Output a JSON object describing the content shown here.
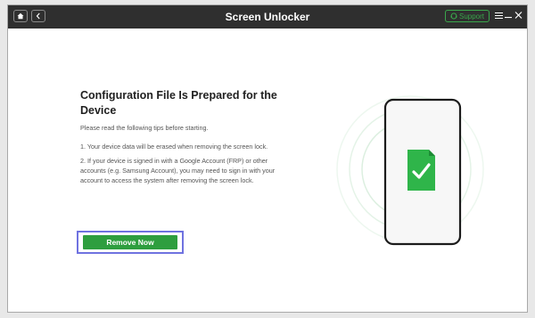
{
  "window": {
    "title": "Screen Unlocker"
  },
  "titlebar": {
    "support_label": "Support"
  },
  "content": {
    "heading": "Configuration File Is Prepared for the Device",
    "intro": "Please read the following tips before starting.",
    "tips": [
      "1. Your device data will be erased when removing the screen lock.",
      "2. If your device is signed in with a Google Account (FRP) or other accounts (e.g. Samsung Account), you may need to sign in with your account to access the system after removing the screen lock."
    ],
    "button_label": "Remove Now"
  },
  "colors": {
    "accent_green": "#2e9e3f",
    "highlight_border": "#6f72e0",
    "titlebar": "#2f2f2f"
  },
  "icons": [
    "home-icon",
    "back-icon",
    "support-icon",
    "menu-icon",
    "minimize-icon",
    "close-icon",
    "phone-icon",
    "file-check-icon"
  ]
}
